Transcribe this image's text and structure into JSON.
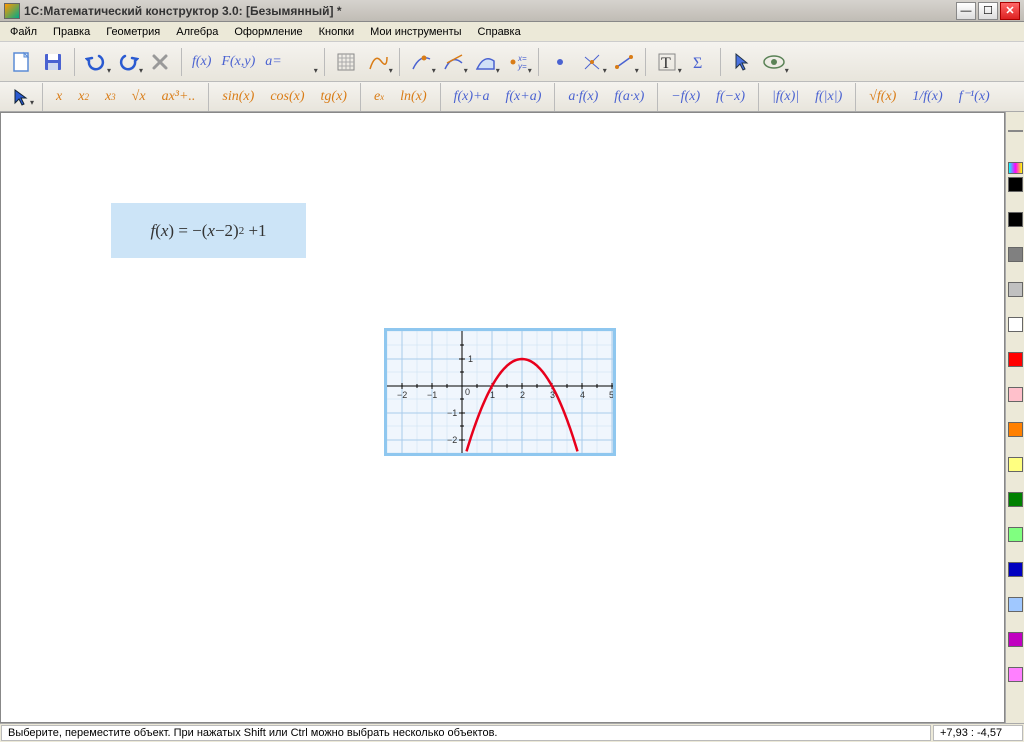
{
  "title": "1С:Математический конструктор 3.0: [Безымянный] *",
  "menu": [
    "Файл",
    "Правка",
    "Геометрия",
    "Алгебра",
    "Оформление",
    "Кнопки",
    "Мои инструменты",
    "Справка"
  ],
  "toolbar1_labels": {
    "fx": "f(x)",
    "fxy": "F(x,y)",
    "ae": "a="
  },
  "toolbar2": {
    "x": "x",
    "x2": "x",
    "x3": "x",
    "sqrt": "√x",
    "axn": "ax³+..",
    "sin": "sin(x)",
    "cos": "cos(x)",
    "tg": "tg(x)",
    "ex": "e",
    "ln": "ln(x)",
    "fpa": "f(x)+a",
    "fxpa": "f(x+a)",
    "afx": "a·f(x)",
    "fax": "f(a·x)",
    "mfx": "−f(x)",
    "fmx": "f(−x)",
    "absfx": "|f(x)|",
    "fabsx": "f(|x|)",
    "sqrtf": "√f(x)",
    "invf": "1/f(x)",
    "finv": "f⁻¹(x)"
  },
  "formula": "f(x) = −(x−2)² +1",
  "status_text": "Выберите, переместите объект. При нажатых Shift или Ctrl можно выбрать несколько объектов.",
  "coords": "+7,93 : -4,57",
  "colors": [
    "#000000",
    "#000000",
    "#808080",
    "#c0c0c0",
    "#ffffff",
    "#ff0000",
    "#ffc0cb",
    "#ff8000",
    "#ffff80",
    "#008000",
    "#80ff80",
    "#0000c0",
    "#a0c8ff",
    "#c000c0",
    "#ff80ff"
  ],
  "chart_data": {
    "type": "line",
    "title": "",
    "xlabel": "",
    "ylabel": "",
    "xlim": [
      -2.5,
      5
    ],
    "ylim": [
      -2.5,
      2
    ],
    "xticks": [
      -2,
      -1,
      0,
      1,
      2,
      3,
      4,
      5
    ],
    "yticks": [
      -2,
      -1,
      1
    ],
    "series": [
      {
        "name": "f(x) = -(x-2)^2 + 1",
        "color": "#e8001c",
        "x": [
          0.2,
          0.5,
          1.0,
          1.5,
          2.0,
          2.5,
          3.0,
          3.5,
          3.8
        ],
        "y": [
          -2.24,
          -1.25,
          0.0,
          0.75,
          1.0,
          0.75,
          0.0,
          -1.25,
          -2.24
        ]
      }
    ]
  }
}
